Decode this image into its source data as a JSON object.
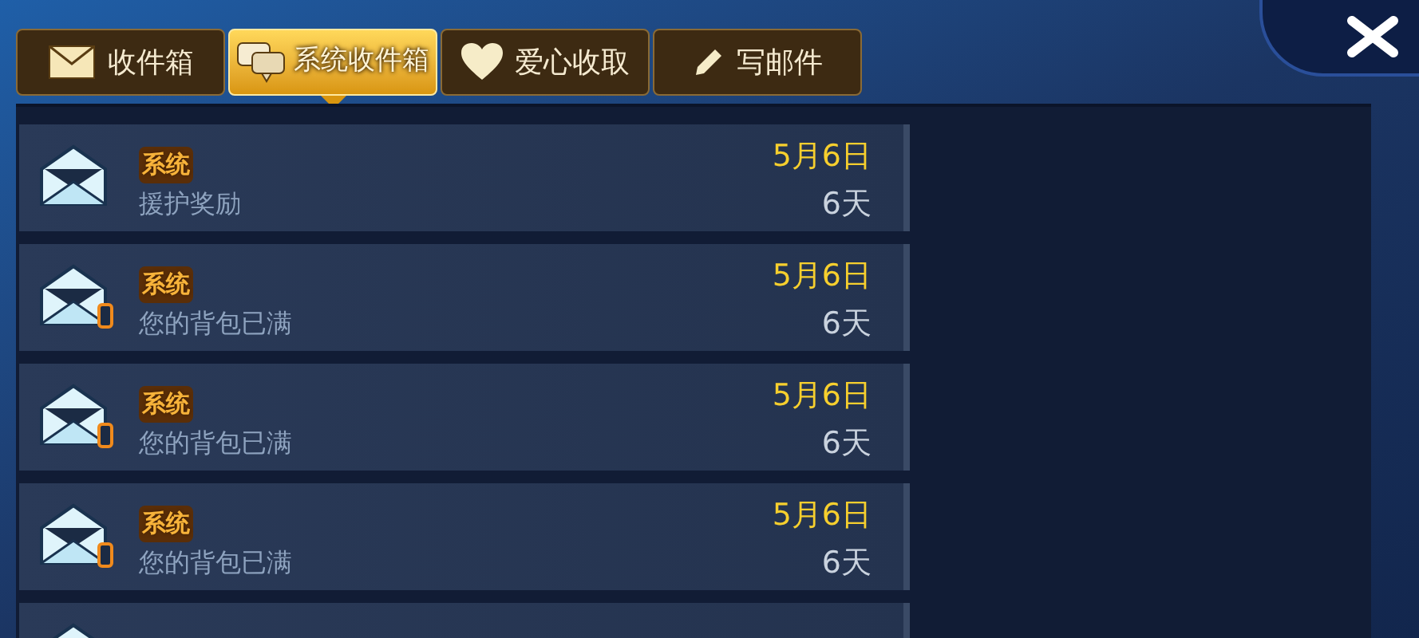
{
  "tabs": [
    {
      "label": "收件箱",
      "kind": "envelope",
      "selected": false
    },
    {
      "label": "系统收件箱",
      "kind": "chat",
      "selected": true
    },
    {
      "label": "爱心收取",
      "kind": "heart",
      "selected": false
    },
    {
      "label": "写邮件",
      "kind": "pencil",
      "selected": false
    }
  ],
  "mails": [
    {
      "sender": "系统",
      "subject": "援护奖励",
      "date": "5月6日",
      "expires": "6天",
      "attachment": false
    },
    {
      "sender": "系统",
      "subject": "您的背包已满",
      "date": "5月6日",
      "expires": "6天",
      "attachment": true
    },
    {
      "sender": "系统",
      "subject": "您的背包已满",
      "date": "5月6日",
      "expires": "6天",
      "attachment": true
    },
    {
      "sender": "系统",
      "subject": "您的背包已满",
      "date": "5月6日",
      "expires": "6天",
      "attachment": true
    }
  ]
}
